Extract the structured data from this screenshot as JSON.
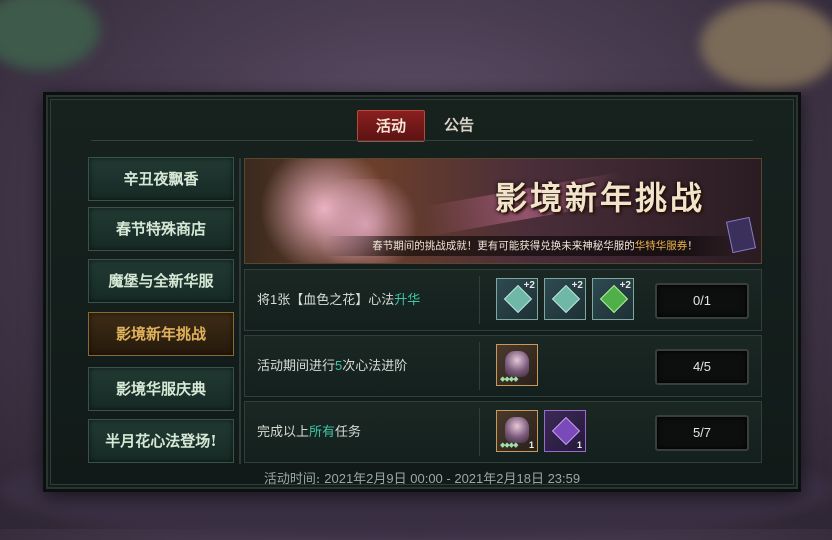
{
  "tabs": [
    {
      "label": "活动",
      "active": true
    },
    {
      "label": "公告",
      "active": false
    }
  ],
  "sidebar": {
    "items": [
      {
        "label": "辛丑夜飘香"
      },
      {
        "label": "春节特殊商店"
      },
      {
        "label": "魔堡与全新华服"
      },
      {
        "label": "影境新年挑战",
        "selected": true
      },
      {
        "label": "影境华服庆典"
      },
      {
        "label": "半月花心法登场!"
      }
    ]
  },
  "banner": {
    "title": "影境新年挑战",
    "subtitle_prefix": "春节期间的挑战成就！更有可能获得兑换未来神秘华服的",
    "subtitle_highlight": "华特华服券",
    "subtitle_suffix": "！"
  },
  "tasks": [
    {
      "text_prefix": "将1张【血色之花】心法",
      "text_highlight": "升华",
      "text_suffix": "",
      "rewards": [
        {
          "icon": "teal-gem-icon",
          "badge": "+2"
        },
        {
          "icon": "teal-gem-icon",
          "badge": "+2"
        },
        {
          "icon": "green-gem-icon",
          "badge": "+2"
        }
      ],
      "progress": "0/1"
    },
    {
      "text_prefix": "活动期间进行",
      "text_highlight": "5",
      "text_suffix": "次心法进阶",
      "rewards": [
        {
          "icon": "portrait-card-icon",
          "badge": ""
        }
      ],
      "progress": "4/5"
    },
    {
      "text_prefix": "完成以上",
      "text_highlight": "所有",
      "text_suffix": "任务",
      "rewards": [
        {
          "icon": "portrait-card-icon",
          "badge": "1"
        },
        {
          "icon": "ticket-card-icon",
          "badge": "1"
        }
      ],
      "progress": "5/7"
    }
  ],
  "footer": {
    "label": "活动时间:",
    "value": "2021年2月9日 00:00 - 2021年2月18日 23:59"
  },
  "colors": {
    "highlight_teal": "#3fc4a6",
    "highlight_gold": "#e9b24a",
    "selected_text": "#e0b25c",
    "active_tab": "#8a1f1f"
  }
}
